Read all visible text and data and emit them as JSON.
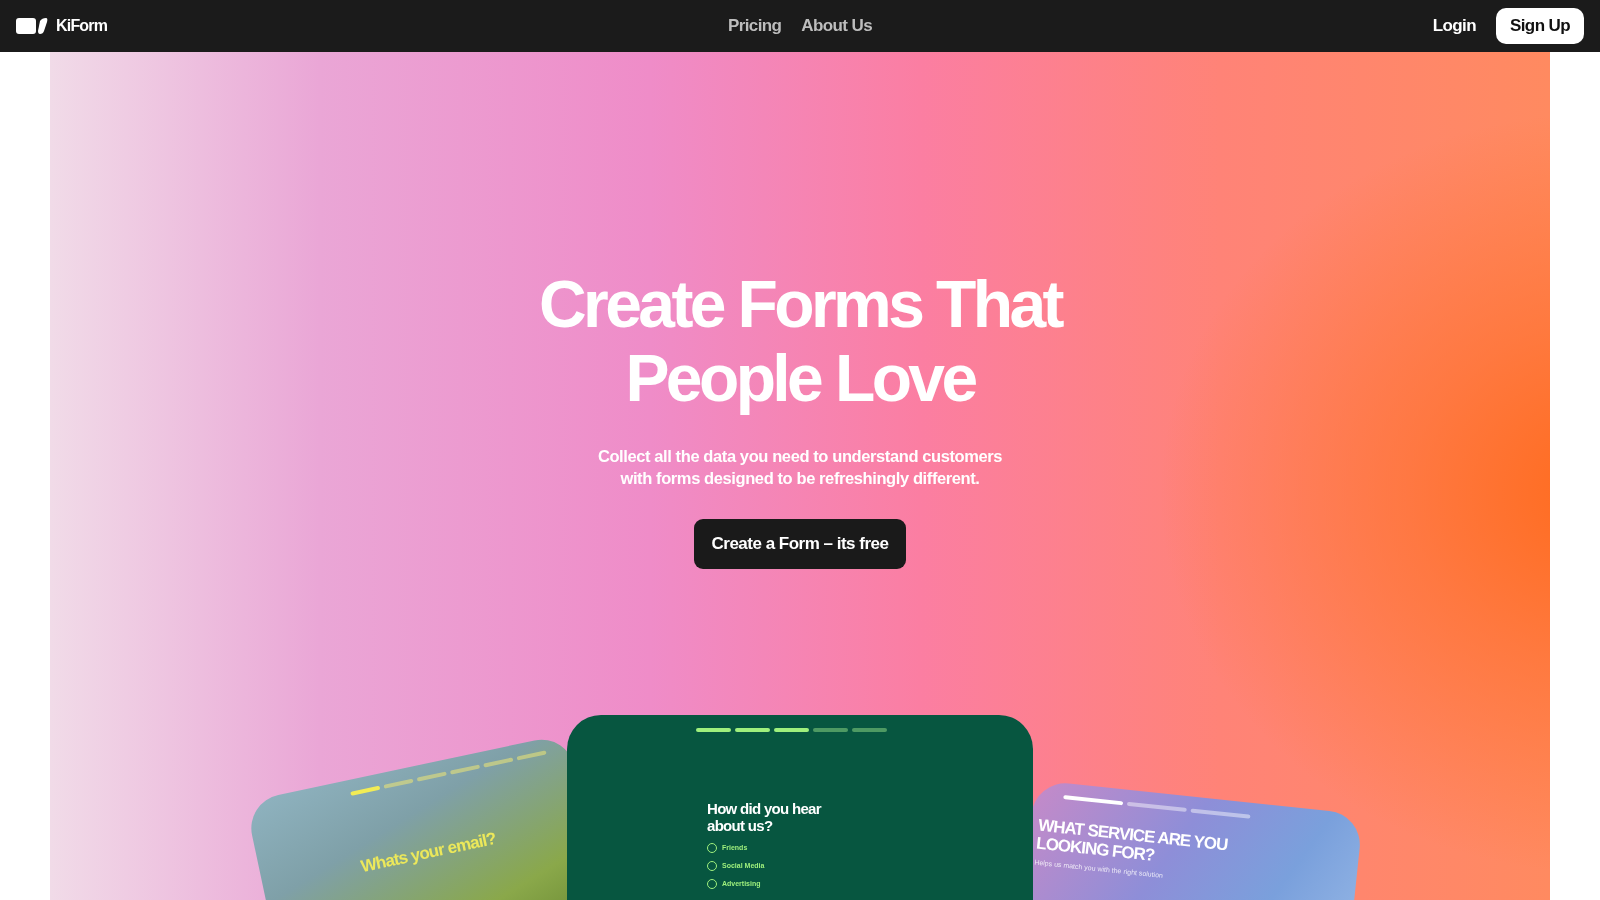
{
  "nav": {
    "brand": "KiForm",
    "links": [
      "Pricing",
      "About Us"
    ],
    "login": "Login",
    "signup": "Sign Up"
  },
  "hero": {
    "title_lines": [
      "Create Forms That",
      "People Love"
    ],
    "subtitle_lines": [
      "Collect all the data you need to understand customers",
      "with forms designed to be refreshingly different."
    ],
    "cta": "Create a Form – its free"
  },
  "form_previews": [
    {
      "kind": "photo",
      "question": "Whats your email?",
      "progress": [
        {
          "on": true
        },
        {
          "on": false
        },
        {
          "on": false
        },
        {
          "on": false
        },
        {
          "on": false
        },
        {
          "on": false
        }
      ]
    },
    {
      "kind": "green",
      "question": "How did you hear about us?",
      "progress": [
        {
          "on": true
        },
        {
          "on": true
        },
        {
          "on": true
        },
        {
          "on": false
        },
        {
          "on": false
        }
      ],
      "options": [
        {
          "label": "Friends",
          "selected": false
        },
        {
          "label": "Social Media",
          "selected": false
        },
        {
          "label": "Advertising",
          "selected": false
        }
      ]
    },
    {
      "kind": "gradient",
      "question": "WHAT SERVICE ARE YOU LOOKING FOR?",
      "hint": "Helps us match you with the right solution",
      "progress": [
        {
          "on": true
        },
        {
          "on": false
        },
        {
          "on": false
        }
      ]
    }
  ]
}
